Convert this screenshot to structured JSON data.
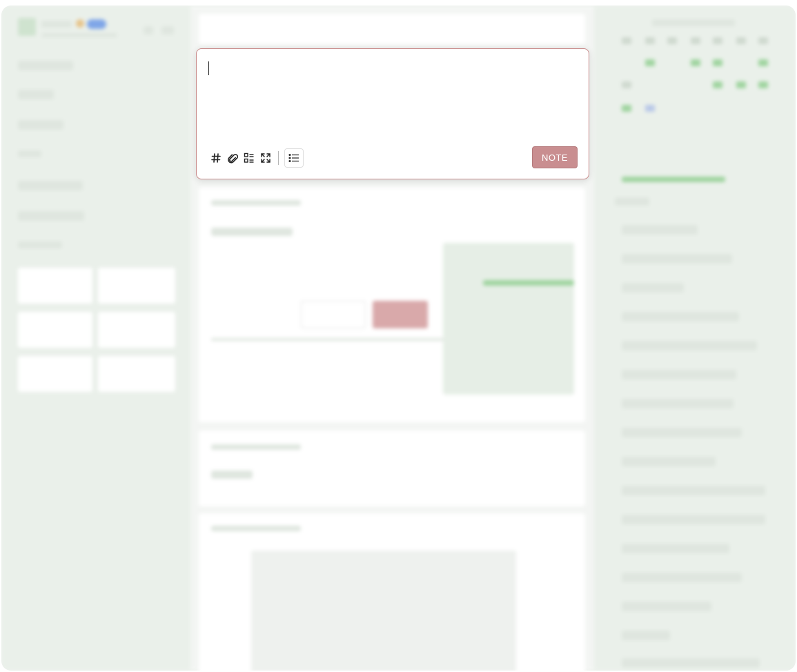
{
  "editor": {
    "content": "",
    "tools": [
      "hash-icon",
      "paperclip-icon",
      "checklist-icon",
      "expand-icon"
    ],
    "list_icon": "bullet-list-icon",
    "submit_label": "NOTE",
    "accent": "#c98e90"
  },
  "background": {
    "blurred": true,
    "layout": "three-column"
  }
}
